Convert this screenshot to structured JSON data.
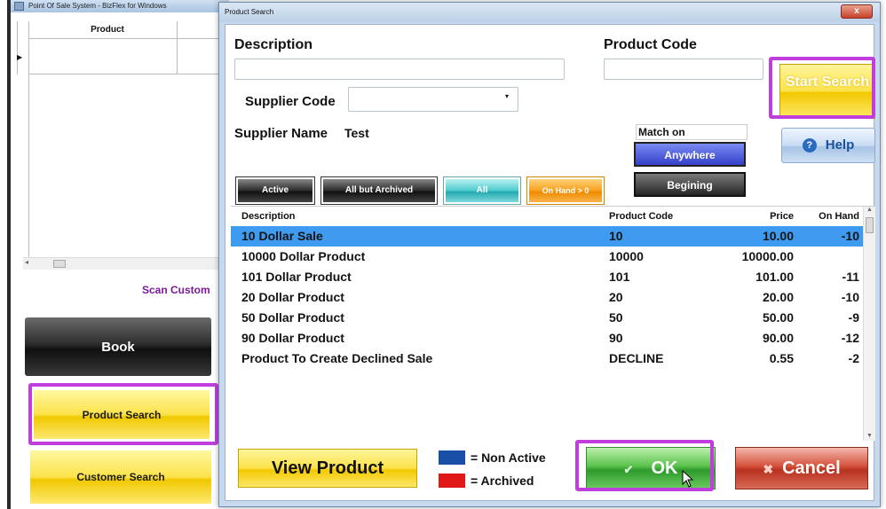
{
  "main_window": {
    "title": "Point Of Sale System - BizFlex for Windows",
    "grid_header_product": "Product",
    "scan_label": "Scan Custom",
    "book_label": "Book",
    "product_search_label": "Product Search",
    "customer_search_label": "Customer Search"
  },
  "dialog": {
    "title": "Product Search",
    "close_label": "x",
    "description_label": "Description",
    "description_value": "",
    "product_code_label": "Product Code",
    "product_code_value": "",
    "supplier_code_label": "Supplier Code",
    "supplier_code_value": "",
    "supplier_name_label": "Supplier Name",
    "supplier_name_value": "Test",
    "start_search_label": "Start Search",
    "help_label": "Help",
    "match_on_label": "Match on",
    "match_anywhere_label": "Anywhere",
    "match_begining_label": "Begining",
    "filters": {
      "active": "Active",
      "all_but_archived": "All but Archived",
      "all": "All",
      "on_hand": "On Hand > 0"
    },
    "grid": {
      "columns": {
        "description": "Description",
        "product_code": "Product Code",
        "price": "Price",
        "on_hand": "On Hand"
      },
      "rows": [
        {
          "description": "10 Dollar Sale",
          "product_code": "10",
          "price": "10.00",
          "on_hand": "-10",
          "selected": true
        },
        {
          "description": "10000 Dollar Product",
          "product_code": "10000",
          "price": "10000.00",
          "on_hand": ""
        },
        {
          "description": "101 Dollar Product",
          "product_code": "101",
          "price": "101.00",
          "on_hand": "-11"
        },
        {
          "description": "20 Dollar Product",
          "product_code": "20",
          "price": "20.00",
          "on_hand": "-10"
        },
        {
          "description": "50 Dollar Product",
          "product_code": "50",
          "price": "50.00",
          "on_hand": "-9"
        },
        {
          "description": "90 Dollar Product",
          "product_code": "90",
          "price": "90.00",
          "on_hand": "-12"
        },
        {
          "description": "Product To Create Declined Sale",
          "product_code": "DECLINE",
          "price": "0.55",
          "on_hand": "-2"
        }
      ]
    },
    "view_product_label": "View Product",
    "legend": {
      "non_active": "= Non Active",
      "archived": "= Archived",
      "non_active_color": "#1a4fa8",
      "archived_color": "#e01818"
    },
    "ok_label": "OK",
    "cancel_label": "Cancel"
  },
  "highlight_color": "#c03fdc"
}
